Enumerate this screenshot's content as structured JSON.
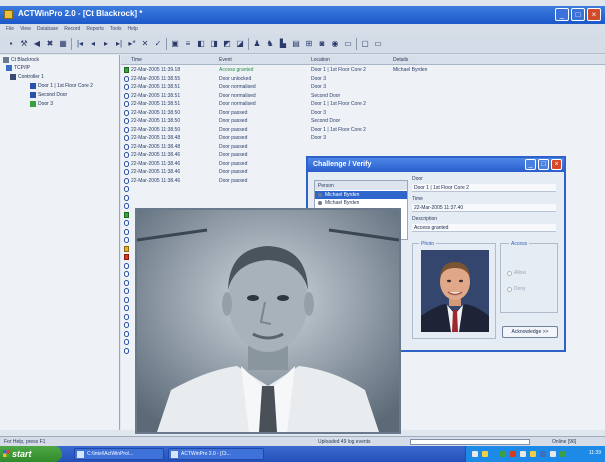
{
  "window": {
    "title": "ACTWinPro 2.0 - [Ct Blackrock] *"
  },
  "menu": {
    "items": [
      "File",
      "View",
      "Database",
      "Record",
      "Reports",
      "Tools",
      "Help"
    ]
  },
  "tree": {
    "items": [
      {
        "label": "Ct Blackrock",
        "icon": "site-icon"
      },
      {
        "label": "TCP/IP",
        "icon": "network-icon"
      },
      {
        "label": "Controller 1",
        "icon": "controller-icon"
      },
      {
        "label": "Door 1 | 1st Floor Core 2",
        "icon": "door-icon"
      },
      {
        "label": "Second Door",
        "icon": "door-icon"
      },
      {
        "label": "Door 3",
        "icon": "door-icon"
      }
    ]
  },
  "grid": {
    "columns": [
      "Time",
      "Event",
      "Location",
      "Details"
    ],
    "rows": [
      {
        "icon": "access",
        "time": "22-Mar-2005 11:39.18",
        "event": "Access granted",
        "location": "Door 1 | 1st Floor Core 2",
        "details": "Michael Byrden"
      },
      {
        "icon": "door",
        "time": "22-Mar-2005 11:38.55",
        "event": "Door unlocked",
        "location": "Door 3",
        "details": ""
      },
      {
        "icon": "door",
        "time": "22-Mar-2005 11:38.51",
        "event": "Door normalised",
        "location": "Door 3",
        "details": ""
      },
      {
        "icon": "door",
        "time": "22-Mar-2005 11:38.51",
        "event": "Door normalised",
        "location": "Second Door",
        "details": ""
      },
      {
        "icon": "door",
        "time": "22-Mar-2005 11:38.51",
        "event": "Door normalised",
        "location": "Door 1 | 1st Floor Core 2",
        "details": ""
      },
      {
        "icon": "door",
        "time": "22-Mar-2005 11:38.50",
        "event": "Door passed",
        "location": "Door 3",
        "details": ""
      },
      {
        "icon": "door",
        "time": "22-Mar-2005 11:38.50",
        "event": "Door passed",
        "location": "Second Door",
        "details": ""
      },
      {
        "icon": "door",
        "time": "22-Mar-2005 11:38.50",
        "event": "Door passed",
        "location": "Door 1 | 1st Floor Core 2",
        "details": ""
      },
      {
        "icon": "door",
        "time": "22-Mar-2005 11:38.48",
        "event": "Door passed",
        "location": "Door 3",
        "details": ""
      },
      {
        "icon": "door",
        "time": "22-Mar-2005 11:38.48",
        "event": "Door passed",
        "location": "",
        "details": ""
      },
      {
        "icon": "door",
        "time": "22-Mar-2005 11:38.46",
        "event": "Door passed",
        "location": "",
        "details": ""
      },
      {
        "icon": "door",
        "time": "22-Mar-2005 11:38.46",
        "event": "Door passed",
        "location": "",
        "details": ""
      },
      {
        "icon": "door",
        "time": "22-Mar-2005 11:38.46",
        "event": "Door passed",
        "location": "",
        "details": ""
      },
      {
        "icon": "door",
        "time": "22-Mar-2005 11:38.46",
        "event": "Door passed",
        "location": "",
        "details": ""
      }
    ],
    "extra_row_icons": [
      "door",
      "door",
      "door",
      "access",
      "door",
      "door",
      "door",
      "warn",
      "alarm",
      "door",
      "door",
      "door",
      "door",
      "door",
      "door",
      "door",
      "door",
      "door",
      "door",
      "door"
    ]
  },
  "dialog": {
    "title": "Challenge / Verify",
    "person_header": "Person",
    "persons": [
      "Michael Byrden",
      "Michael Byrden"
    ],
    "door_label": "Door",
    "door_value": "Door 1 | 1st Floor Core 2",
    "time_label": "Time",
    "time_value": "22-Mar-2005 11:37.40",
    "description_label": "Description",
    "description_value": "Access granted",
    "photo_label": "Photo",
    "access_label": "Access",
    "allow_label": "Allow",
    "deny_label": "Deny",
    "ack_label": "Acknowledge >>"
  },
  "status": {
    "help": "For Help, press F1",
    "uploaded": "Uploaded 49 log events",
    "online": "Online [96]"
  },
  "taskbar": {
    "start": "start",
    "tasks": [
      "C:\\Intel\\ActWinPro\\...",
      "ACTWinPro 2.0 - [Ct..."
    ],
    "clock": "11:39"
  },
  "colors": {
    "titlebar": "#2a63d4",
    "accent": "#2f66cc",
    "access": "#3aa040",
    "alarm": "#d83a20"
  }
}
